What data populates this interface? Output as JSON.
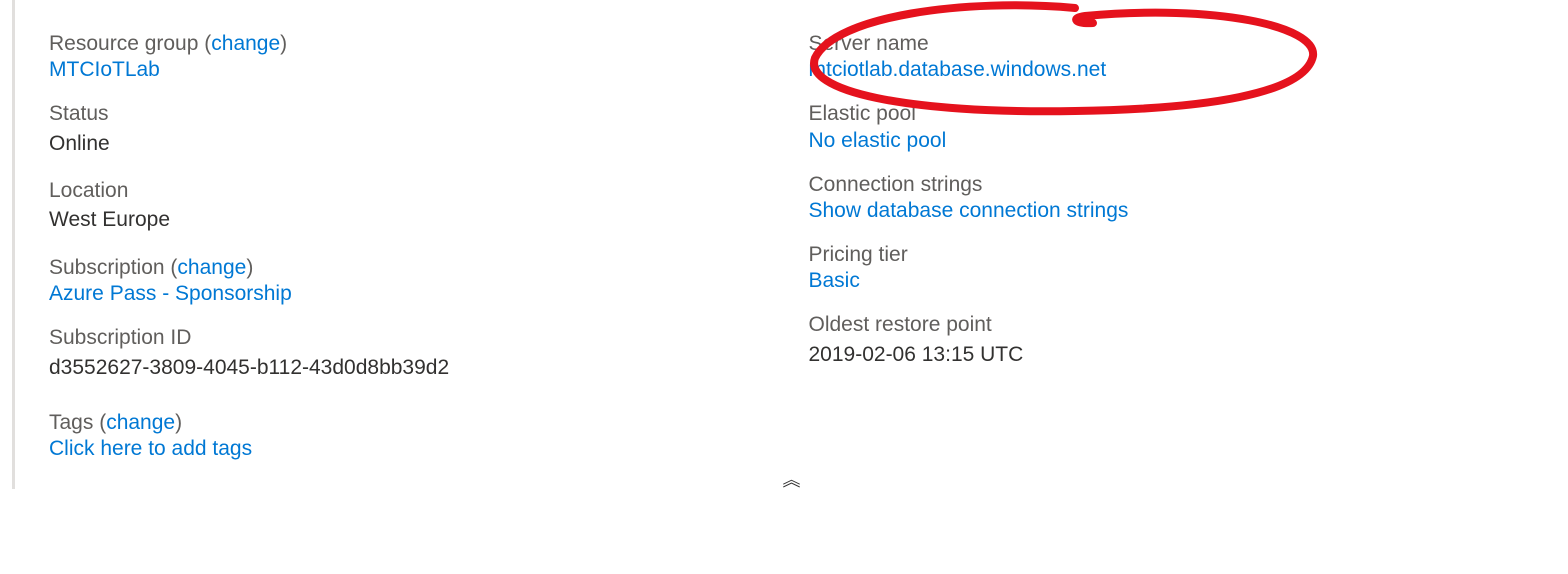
{
  "left": {
    "resource_group": {
      "label": "Resource group",
      "change": "change",
      "value": "MTCIoTLab"
    },
    "status": {
      "label": "Status",
      "value": "Online"
    },
    "location": {
      "label": "Location",
      "value": "West Europe"
    },
    "subscription": {
      "label": "Subscription",
      "change": "change",
      "value": "Azure Pass - Sponsorship"
    },
    "subscription_id": {
      "label": "Subscription ID",
      "value": "d3552627-3809-4045-b112-43d0d8bb39d2"
    },
    "tags": {
      "label": "Tags",
      "change": "change",
      "value": "Click here to add tags"
    }
  },
  "right": {
    "server_name": {
      "label": "Server name",
      "value": "mtciotlab.database.windows.net"
    },
    "elastic_pool": {
      "label": "Elastic pool",
      "value": "No elastic pool"
    },
    "connection_strings": {
      "label": "Connection strings",
      "value": "Show database connection strings"
    },
    "pricing_tier": {
      "label": "Pricing tier",
      "value": "Basic"
    },
    "oldest_restore": {
      "label": "Oldest restore point",
      "value": "2019-02-06 13:15 UTC"
    }
  },
  "collapse_glyph": "︽"
}
